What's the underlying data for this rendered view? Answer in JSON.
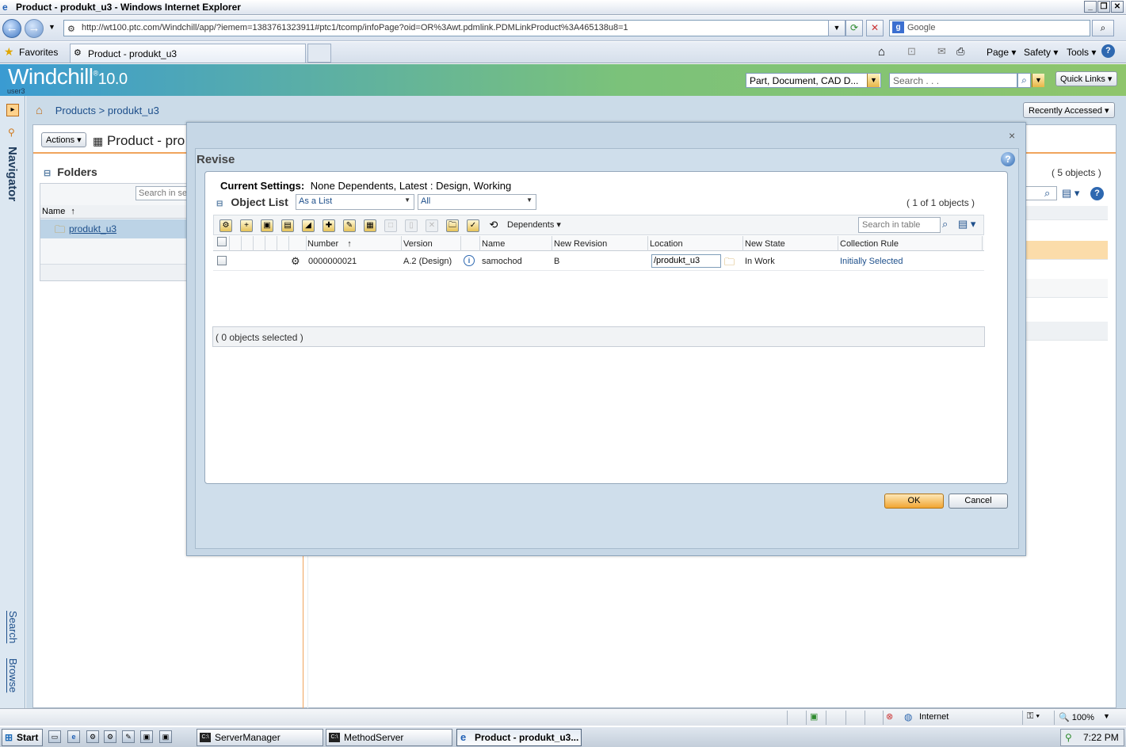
{
  "browser": {
    "title": "Product - produkt_u3 - Windows Internet Explorer",
    "url": "http://wt100.ptc.com/Windchill/app/?iemem=1383761323911#ptc1/tcomp/infoPage?oid=OR%3Awt.pdmlink.PDMLinkProduct%3A465138u8=1",
    "search_placeholder": "Google",
    "favorites_label": "Favorites",
    "tab_label": "Product - produkt_u3",
    "menu_page": "Page",
    "menu_safety": "Safety",
    "menu_tools": "Tools"
  },
  "windchill": {
    "logo": "Windchill",
    "version": "10.0",
    "user": "user3",
    "type_select": "Part, Document, CAD D...",
    "search_placeholder": "Search . . .",
    "quick_links": "Quick Links",
    "recently_accessed": "Recently Accessed",
    "navigator_label": "Navigator",
    "search_tab": "Search",
    "browse_tab": "Browse",
    "breadcrumb_root": "Products",
    "breadcrumb_sep": ">",
    "breadcrumb_current": "produkt_u3"
  },
  "page": {
    "actions": "Actions",
    "title": "Product - pro",
    "folders_header": "Folders",
    "left_search_placeholder": "Search in sel",
    "name_column": "Name",
    "folder_item": "produkt_u3",
    "right_count": "( 5 objects )"
  },
  "dialog": {
    "title": "Revise",
    "current_settings_label": "Current Settings:",
    "current_settings_value": "None Dependents, Latest : Design, Working",
    "object_list_label": "Object List",
    "view_select": "As a List",
    "filter_select": "All",
    "object_count": "( 1 of 1 objects )",
    "dependents_button": "Dependents",
    "table_search_placeholder": "Search in table",
    "columns": [
      "Number",
      "Version",
      "Name",
      "New Revision",
      "Location",
      "New State",
      "Collection Rule"
    ],
    "rows": [
      {
        "number": "0000000021",
        "version": "A.2 (Design)",
        "name": "samochod",
        "new_revision": "B",
        "location": "/produkt_u3",
        "new_state": "In Work",
        "collection_rule": "Initially Selected"
      }
    ],
    "selected_status": "( 0 objects selected )",
    "ok_label": "OK",
    "cancel_label": "Cancel"
  },
  "statusbar": {
    "zone": "Internet",
    "zoom": "100%"
  },
  "taskbar": {
    "start": "Start",
    "tasks": [
      "ServerManager",
      "MethodServer",
      "Product - produkt_u3..."
    ],
    "time": "7:22 PM"
  }
}
